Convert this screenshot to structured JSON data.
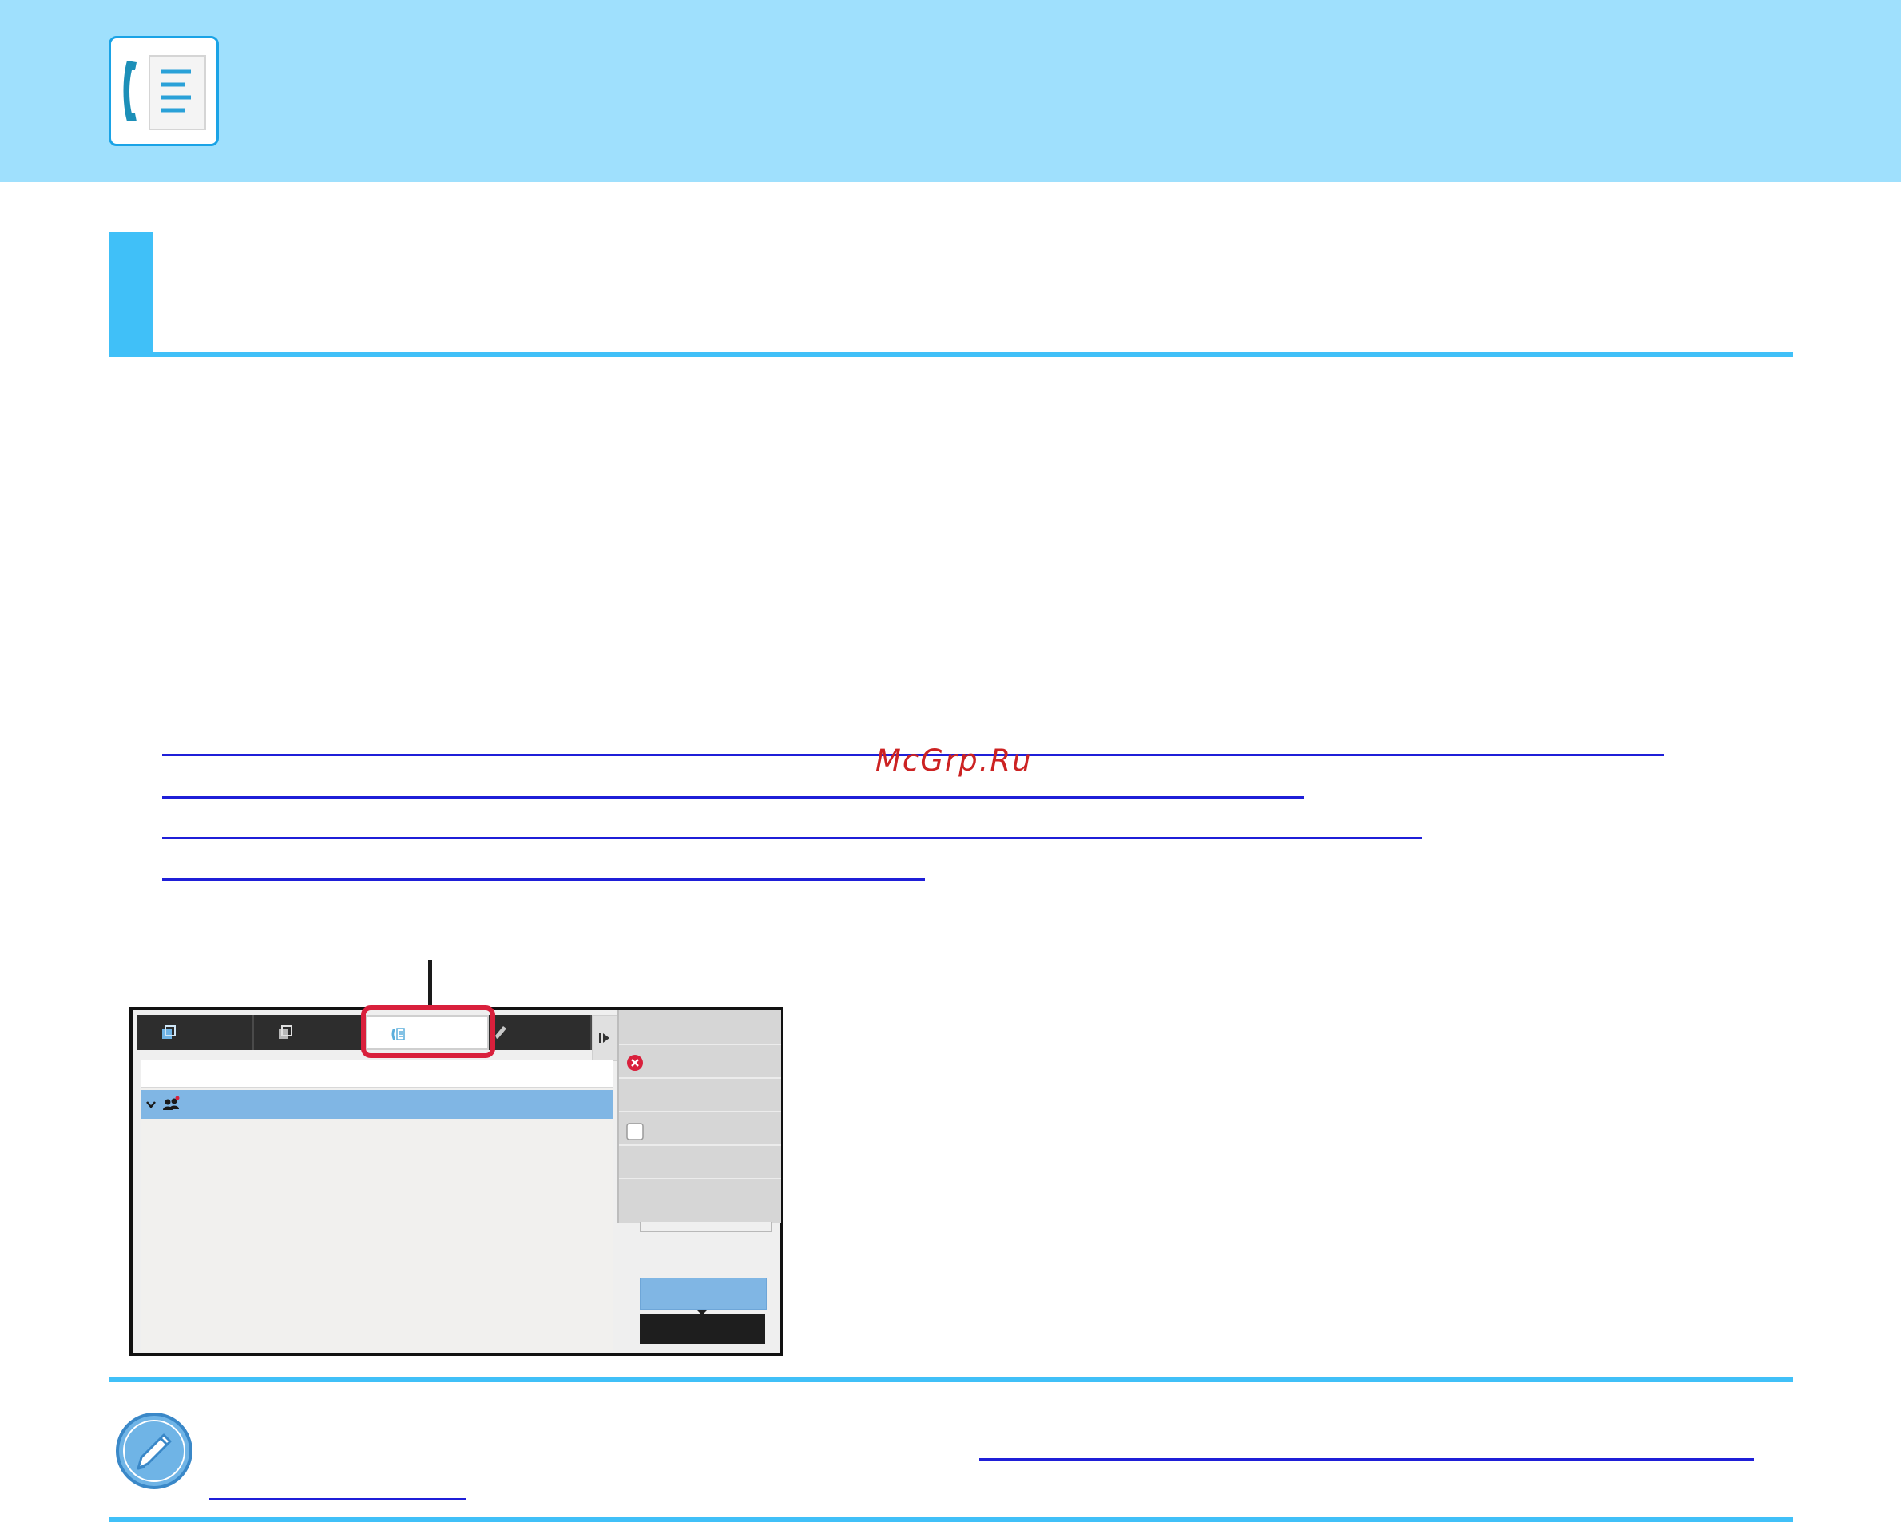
{
  "watermark": {
    "text": "McGrp.Ru"
  },
  "colors": {
    "header_band": "#9fe0fd",
    "accent": "#40c0f8",
    "link": "#1f1fd8",
    "highlight": "#d9203c",
    "selected_row": "#80b6e4"
  },
  "icons": {
    "header": "fax-document-icon",
    "note": "pencil-note-icon",
    "tabs": [
      "copy-icon",
      "scan-icon",
      "fax-icon",
      "edit-icon"
    ],
    "tab_next": "tab-next-arrow-icon",
    "side_panel": [
      "error-icon",
      "checkbox-icon"
    ],
    "selected_row": [
      "chevron-down-icon",
      "group-icon"
    ]
  },
  "screen": {
    "active_tab_index": 2,
    "tab_count": 4,
    "side_checkbox_checked": false
  }
}
